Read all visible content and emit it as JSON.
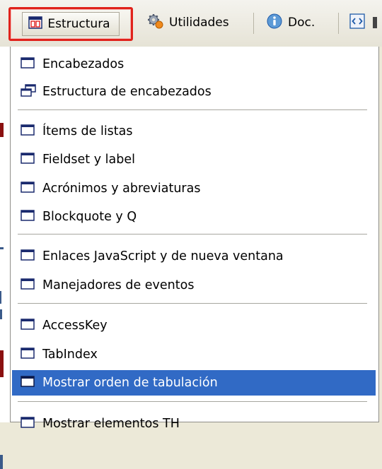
{
  "toolbar": {
    "estructura": "Estructura",
    "utilidades": "Utilidades",
    "doc": "Doc."
  },
  "menu": {
    "items": [
      {
        "label": "Encabezados"
      },
      {
        "label": "Estructura de encabezados"
      },
      {
        "label": "Ítems de listas"
      },
      {
        "label": "Fieldset y label"
      },
      {
        "label": "Acrónimos y abreviaturas"
      },
      {
        "label": "Blockquote y Q"
      },
      {
        "label": "Enlaces JavaScript y de nueva ventana"
      },
      {
        "label": "Manejadores de eventos"
      },
      {
        "label": "AccessKey"
      },
      {
        "label": "TabIndex"
      },
      {
        "label": "Mostrar orden de tabulación"
      },
      {
        "label": "Mostrar elementos TH"
      }
    ]
  },
  "colors": {
    "selection": "#316ac5",
    "highlight_border": "#e0221b",
    "icon_stroke": "#1a2a6e"
  }
}
